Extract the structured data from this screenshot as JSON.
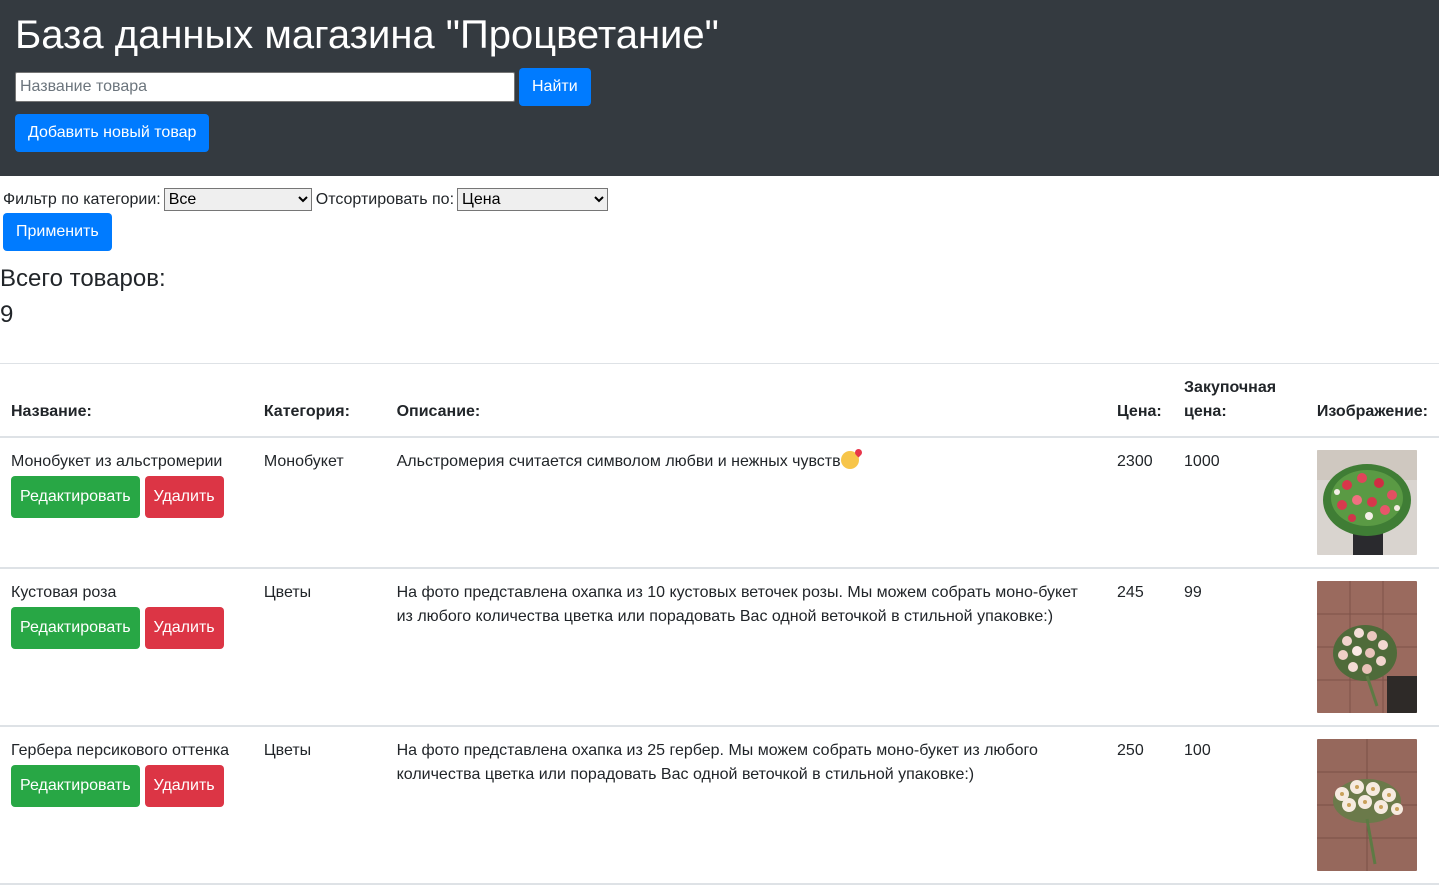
{
  "header": {
    "title": "База данных магазина \"Процветание\"",
    "search_placeholder": "Название товара",
    "search_value": "",
    "find_label": "Найти",
    "add_label": "Добавить новый товар"
  },
  "filters": {
    "category_label": "Фильтр по категории:",
    "category_selected": "Все",
    "sort_label": "Отсортировать по:",
    "sort_selected": "Цена",
    "apply_label": "Применить"
  },
  "summary": {
    "total_label": "Всего товаров:",
    "total_value": "9"
  },
  "table": {
    "headers": {
      "name": "Название:",
      "category": "Категория:",
      "description": "Описание:",
      "price": "Цена:",
      "purchase_price": "Закупочная цена:",
      "image": "Изображение:"
    },
    "edit_label": "Редактировать",
    "delete_label": "Удалить",
    "rows": [
      {
        "name": "Монобукет из альстромерии",
        "category": "Монобукет",
        "description": "Альстромерия считается символом любви и нежных чувств",
        "price": "2300",
        "purchase_price": "1000",
        "image_icon": "alstroemeria-bouquet-photo"
      },
      {
        "name": "Кустовая роза",
        "category": "Цветы",
        "description": "На фото представлена охапка из 10 кустовых веточек розы. Мы можем собрать моно-букет из любого количества цветка или порадовать Вас одной веточкой в стильной упаковке:)",
        "price": "245",
        "purchase_price": "99",
        "image_icon": "spray-rose-photo"
      },
      {
        "name": "Гербера персикового оттенка",
        "category": "Цветы",
        "description": "На фото представлена охапка из 25 гербер. Мы можем собрать моно-букет из любого количества цветка или порадовать Вас одной веточкой в стильной упаковке:)",
        "price": "250",
        "purchase_price": "100",
        "image_icon": "gerbera-photo"
      }
    ]
  }
}
